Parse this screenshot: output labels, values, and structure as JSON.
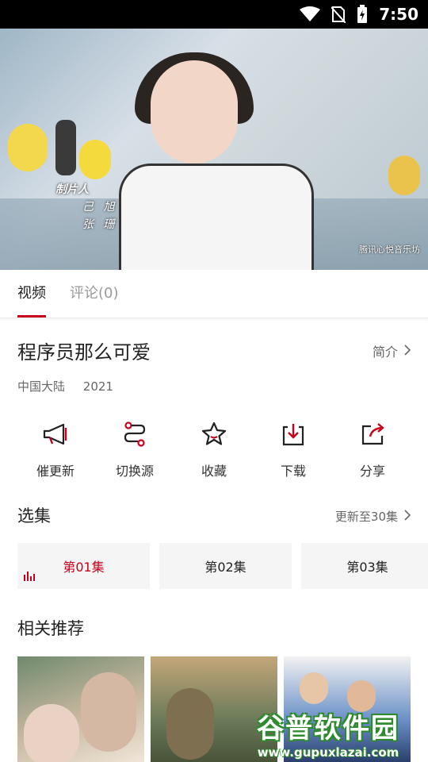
{
  "status_bar": {
    "time": "7:50"
  },
  "video": {
    "credit_role": "制片人",
    "credit_names": [
      "己 旭",
      "张 珊"
    ],
    "watermark": "腾讯心悦音乐坊"
  },
  "tabs": [
    {
      "label": "视频",
      "active": true
    },
    {
      "label": "评论(0)",
      "active": false
    }
  ],
  "show": {
    "title": "程序员那么可爱",
    "intro_label": "简介",
    "region": "中国大陆",
    "year": "2021"
  },
  "actions": [
    {
      "label": "催更新",
      "icon": "megaphone-icon"
    },
    {
      "label": "切换源",
      "icon": "switch-source-icon"
    },
    {
      "label": "收藏",
      "icon": "star-icon"
    },
    {
      "label": "下载",
      "icon": "download-icon"
    },
    {
      "label": "分享",
      "icon": "share-icon"
    }
  ],
  "episodes_section": {
    "title": "选集",
    "update_label": "更新至30集",
    "items": [
      {
        "label": "第01集",
        "active": true
      },
      {
        "label": "第02集",
        "active": false
      },
      {
        "label": "第03集",
        "active": false
      }
    ]
  },
  "recommend_section": {
    "title": "相关推荐"
  },
  "watermark_logo": {
    "name": "谷普软件园",
    "url": "www.gupuxlazai.com"
  },
  "colors": {
    "accent": "#c7001b",
    "status_bar": "#000000"
  }
}
